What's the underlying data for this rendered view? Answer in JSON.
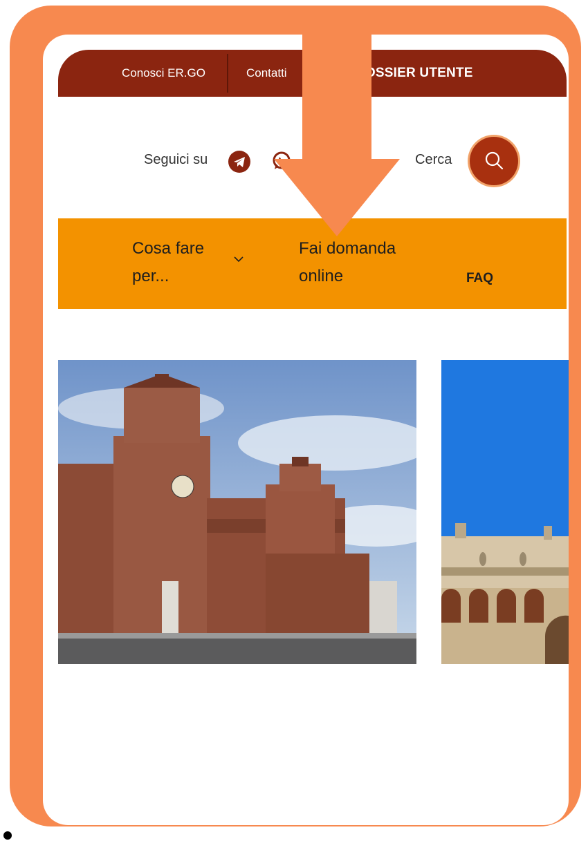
{
  "topbar": {
    "conosci": "Conosci ER.GO",
    "contatti": "Contatti",
    "dossier": "DOSSIER UTENTE"
  },
  "social": {
    "follow_label": "Seguici su",
    "search_label": "Cerca"
  },
  "menu": {
    "cosa_fare": "Cosa fare per...",
    "fai_domanda": "Fai domanda online",
    "faq": "FAQ"
  },
  "colors": {
    "brand_dark": "#8b2510",
    "menu_yellow": "#f39200",
    "frame_orange": "#f7894f",
    "arrow_orange": "#f7894f"
  },
  "icons": [
    "telegram-icon",
    "whatsapp-icon",
    "search-icon",
    "chevron-down-icon",
    "down-arrow-overlay"
  ]
}
